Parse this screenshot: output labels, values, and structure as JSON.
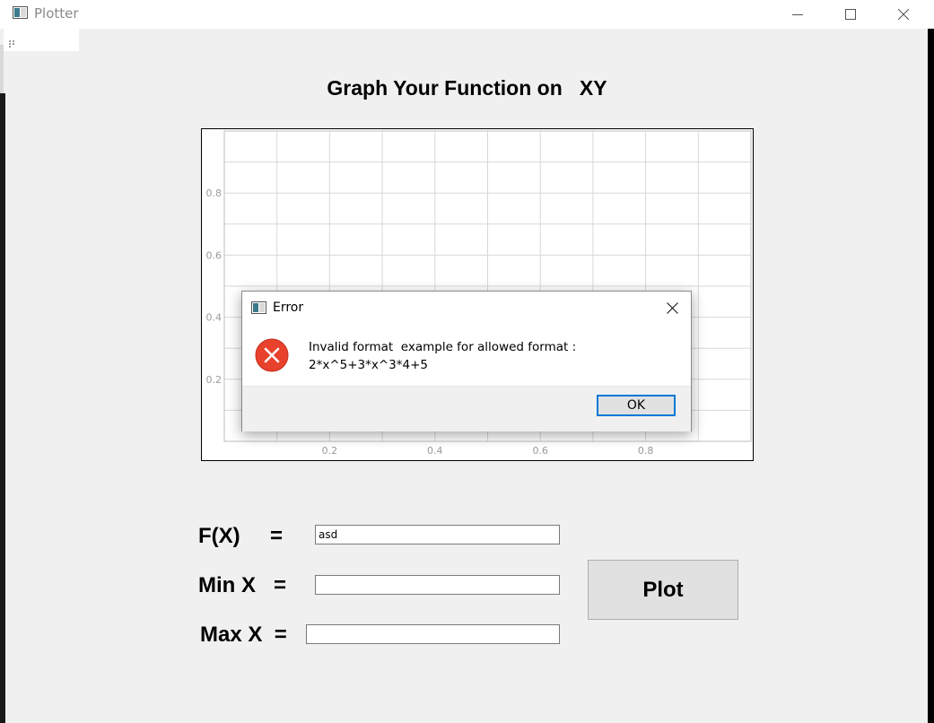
{
  "window": {
    "title": "Plotter",
    "controls": {
      "minimize": "minimize-icon",
      "maximize": "maximize-icon",
      "close": "close-icon"
    }
  },
  "heading": "Graph Your Function on   XY",
  "plot": {
    "chart_data": {
      "type": "line",
      "series": [],
      "x_ticks": [
        "0.2",
        "0.4",
        "0.6",
        "0.8"
      ],
      "y_ticks": [
        "0.2",
        "0.4",
        "0.6",
        "0.8"
      ],
      "xlim": [
        0,
        1
      ],
      "ylim": [
        0,
        1
      ],
      "grid": true,
      "colors": {
        "grid": "#d8d8d8",
        "tick": "#9a9a9a"
      }
    }
  },
  "dialog": {
    "title": "Error",
    "message_line1": "Invalid format  example for allowed format :",
    "message_line2": "2*x^5+3*x^3*4+5",
    "ok_label": "OK",
    "icon": "error-icon",
    "accent": "#e8412c"
  },
  "form": {
    "fx_label": "F(X)     =",
    "fx_value": "asd",
    "minx_label": "Min X   =",
    "minx_value": "",
    "maxx_label": "Max X  =",
    "maxx_value": "",
    "plot_label": "Plot"
  }
}
